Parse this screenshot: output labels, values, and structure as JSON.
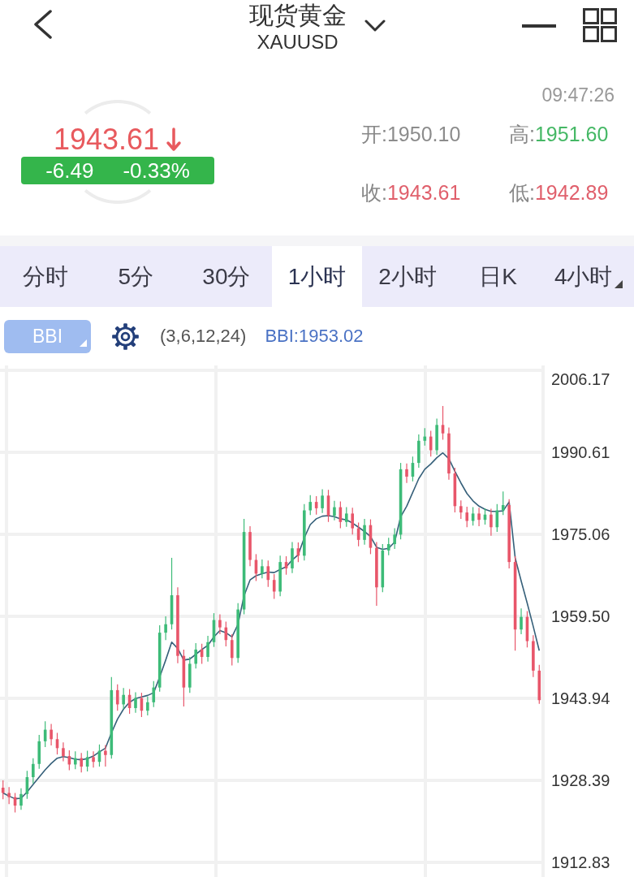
{
  "header": {
    "title": "现货黄金",
    "symbol": "XAUUSD"
  },
  "quote": {
    "time": "09:47:26",
    "price": "1943.61",
    "rising": false,
    "change": "-6.49",
    "change_percent": "-0.33%",
    "stats": [
      {
        "label": "开:",
        "value": "1950.10",
        "color": "#8c8c8c"
      },
      {
        "label": "高:",
        "value": "1951.60",
        "color": "#45b865"
      },
      {
        "label": "收:",
        "value": "1943.61",
        "color": "#e0606c"
      },
      {
        "label": "低:",
        "value": "1942.89",
        "color": "#e0606c"
      }
    ]
  },
  "tabs": [
    {
      "label": "分时",
      "selected": false,
      "dropdown": false
    },
    {
      "label": "5分",
      "selected": false,
      "dropdown": false
    },
    {
      "label": "30分",
      "selected": false,
      "dropdown": false
    },
    {
      "label": "1小时",
      "selected": true,
      "dropdown": false
    },
    {
      "label": "2小时",
      "selected": false,
      "dropdown": false
    },
    {
      "label": "日K",
      "selected": false,
      "dropdown": false
    },
    {
      "label": "4小时",
      "selected": false,
      "dropdown": true
    }
  ],
  "indicator": {
    "name": "BBI",
    "dropdown": true,
    "params": "(3,6,12,24)",
    "reading": "BBI:1953.02"
  },
  "chart": {
    "chart_data": {
      "type": "candlestick",
      "grid": true,
      "ylim": [
        1912.83,
        2006.17
      ],
      "yticks": [
        {
          "value": 2006.17,
          "label": "2006.17"
        },
        {
          "value": 1990.61,
          "label": "1990.61"
        },
        {
          "value": 1975.06,
          "label": "1975.06"
        },
        {
          "value": 1959.5,
          "label": "1959.50"
        },
        {
          "value": 1943.94,
          "label": "1943.94"
        },
        {
          "value": 1928.39,
          "label": "1928.39"
        },
        {
          "value": 1912.83,
          "label": "1912.83"
        }
      ],
      "categories": [
        null,
        null,
        null,
        null,
        null,
        null,
        null,
        null,
        null,
        null,
        null,
        null,
        null,
        null,
        null,
        null,
        null,
        null,
        null,
        null,
        null,
        null,
        null,
        null,
        null,
        null,
        null,
        null,
        null,
        null,
        null,
        null,
        null,
        null,
        null,
        null,
        null,
        null,
        null,
        null,
        null,
        null,
        null,
        null,
        null,
        null,
        null,
        null,
        null,
        null,
        null,
        null,
        null,
        null,
        null,
        null,
        null,
        null,
        null,
        null,
        null,
        null,
        null,
        null,
        null,
        null,
        null,
        null,
        null,
        null,
        null,
        null,
        null,
        null,
        null,
        null,
        null,
        null,
        null,
        null,
        null,
        null,
        null,
        null,
        null,
        null,
        null,
        null,
        null,
        null
      ],
      "ohlc": [
        [
          1927.0,
          1928.4,
          1924.8,
          1926.0
        ],
        [
          1926.0,
          1927.1,
          1923.9,
          1925.2
        ],
        [
          1925.2,
          1926.0,
          1922.3,
          1923.6
        ],
        [
          1923.6,
          1926.9,
          1922.8,
          1925.8
        ],
        [
          1925.8,
          1930.2,
          1924.9,
          1929.0
        ],
        [
          1929.0,
          1932.6,
          1927.8,
          1931.5
        ],
        [
          1931.5,
          1937.0,
          1930.6,
          1935.8
        ],
        [
          1935.8,
          1939.6,
          1934.7,
          1938.0
        ],
        [
          1938.0,
          1939.1,
          1935.0,
          1936.2
        ],
        [
          1936.2,
          1937.4,
          1933.3,
          1934.5
        ],
        [
          1934.5,
          1935.6,
          1932.0,
          1933.0
        ],
        [
          1933.0,
          1934.1,
          1930.3,
          1931.4
        ],
        [
          1931.4,
          1933.9,
          1930.5,
          1932.6
        ],
        [
          1932.6,
          1933.6,
          1929.9,
          1931.0
        ],
        [
          1931.0,
          1934.0,
          1930.1,
          1932.8
        ],
        [
          1932.8,
          1933.9,
          1930.8,
          1931.9
        ],
        [
          1931.9,
          1935.2,
          1931.0,
          1934.0
        ],
        [
          1934.0,
          1935.1,
          1931.0,
          1933.2
        ],
        [
          1933.2,
          1948.0,
          1932.5,
          1945.5
        ],
        [
          1945.5,
          1946.6,
          1941.6,
          1942.8
        ],
        [
          1942.8,
          1945.9,
          1941.9,
          1944.6
        ],
        [
          1944.6,
          1945.7,
          1941.0,
          1942.1
        ],
        [
          1942.1,
          1945.1,
          1941.2,
          1944.0
        ],
        [
          1944.0,
          1945.0,
          1940.4,
          1941.6
        ],
        [
          1941.6,
          1944.3,
          1940.7,
          1943.2
        ],
        [
          1943.2,
          1947.2,
          1942.3,
          1946.0
        ],
        [
          1946.0,
          1957.8,
          1945.2,
          1956.4
        ],
        [
          1956.4,
          1959.5,
          1955.0,
          1958.0
        ],
        [
          1958.0,
          1970.6,
          1957.0,
          1963.5
        ],
        [
          1963.5,
          1965.0,
          1950.6,
          1952.0
        ],
        [
          1952.0,
          1953.2,
          1942.4,
          1946.0
        ],
        [
          1946.0,
          1951.8,
          1945.0,
          1950.5
        ],
        [
          1950.5,
          1954.4,
          1949.6,
          1953.2
        ],
        [
          1953.2,
          1954.3,
          1950.5,
          1951.8
        ],
        [
          1951.8,
          1955.8,
          1950.9,
          1954.6
        ],
        [
          1954.6,
          1960.1,
          1953.7,
          1958.8
        ],
        [
          1958.8,
          1959.9,
          1956.1,
          1957.4
        ],
        [
          1957.4,
          1958.5,
          1953.8,
          1955.0
        ],
        [
          1955.0,
          1956.1,
          1950.2,
          1951.6
        ],
        [
          1951.6,
          1962.0,
          1950.7,
          1960.8
        ],
        [
          1960.8,
          1978.0,
          1959.9,
          1975.5
        ],
        [
          1975.5,
          1976.6,
          1969.0,
          1970.2
        ],
        [
          1970.2,
          1971.3,
          1966.2,
          1967.6
        ],
        [
          1967.6,
          1970.3,
          1966.7,
          1969.0
        ],
        [
          1969.0,
          1970.1,
          1965.1,
          1966.4
        ],
        [
          1966.4,
          1967.5,
          1962.8,
          1964.2
        ],
        [
          1964.2,
          1971.0,
          1963.3,
          1969.8
        ],
        [
          1969.8,
          1970.9,
          1967.4,
          1968.6
        ],
        [
          1968.6,
          1973.6,
          1967.7,
          1972.4
        ],
        [
          1972.4,
          1973.5,
          1969.8,
          1971.0
        ],
        [
          1971.0,
          1980.8,
          1970.1,
          1979.6
        ],
        [
          1979.6,
          1982.5,
          1978.7,
          1981.2
        ],
        [
          1981.2,
          1982.3,
          1978.8,
          1980.0
        ],
        [
          1980.0,
          1983.6,
          1979.1,
          1982.4
        ],
        [
          1982.4,
          1983.5,
          1977.4,
          1978.6
        ],
        [
          1978.6,
          1981.4,
          1977.7,
          1980.2
        ],
        [
          1980.2,
          1981.3,
          1976.2,
          1977.4
        ],
        [
          1977.4,
          1980.2,
          1976.5,
          1979.0
        ],
        [
          1979.0,
          1980.1,
          1975.0,
          1976.2
        ],
        [
          1976.2,
          1977.3,
          1972.8,
          1974.0
        ],
        [
          1974.0,
          1978.0,
          1973.1,
          1976.8
        ],
        [
          1976.8,
          1977.9,
          1971.3,
          1972.5
        ],
        [
          1972.5,
          1973.6,
          1961.5,
          1965.0
        ],
        [
          1965.0,
          1973.2,
          1964.1,
          1972.0
        ],
        [
          1972.0,
          1974.4,
          1971.1,
          1973.2
        ],
        [
          1973.2,
          1976.2,
          1972.3,
          1975.0
        ],
        [
          1975.0,
          1988.6,
          1974.1,
          1987.4
        ],
        [
          1987.4,
          1988.5,
          1984.8,
          1986.0
        ],
        [
          1986.0,
          1989.8,
          1985.1,
          1988.6
        ],
        [
          1988.6,
          1994.0,
          1987.7,
          1992.8
        ],
        [
          1992.8,
          1995.2,
          1991.9,
          1993.6
        ],
        [
          1993.6,
          1994.7,
          1989.8,
          1991.0
        ],
        [
          1991.0,
          1997.0,
          1990.1,
          1995.8
        ],
        [
          1995.8,
          1999.4,
          1993.0,
          1994.2
        ],
        [
          1994.2,
          1995.3,
          1985.4,
          1986.6
        ],
        [
          1986.6,
          1987.7,
          1979.2,
          1980.4
        ],
        [
          1980.4,
          1981.5,
          1978.0,
          1979.2
        ],
        [
          1979.2,
          1980.3,
          1976.4,
          1977.6
        ],
        [
          1977.6,
          1980.2,
          1976.7,
          1979.0
        ],
        [
          1979.0,
          1980.1,
          1976.6,
          1977.8
        ],
        [
          1977.8,
          1980.0,
          1976.9,
          1978.8
        ],
        [
          1978.8,
          1979.9,
          1974.8,
          1976.4
        ],
        [
          1976.4,
          1980.8,
          1975.5,
          1979.6
        ],
        [
          1979.6,
          1983.2,
          1978.7,
          1980.6
        ],
        [
          1980.6,
          1981.7,
          1968.6,
          1969.8
        ],
        [
          1969.8,
          1970.9,
          1953.0,
          1957.0
        ],
        [
          1957.0,
          1961.0,
          1956.1,
          1959.4
        ],
        [
          1959.4,
          1960.5,
          1953.6,
          1954.8
        ],
        [
          1954.8,
          1955.9,
          1948.0,
          1949.2
        ],
        [
          1949.2,
          1950.3,
          1942.9,
          1943.6
        ]
      ],
      "series": [
        {
          "type": "line",
          "color": "#36607a",
          "values": [
            1926.0,
            1925.4,
            1924.9,
            1925.0,
            1926.2,
            1927.6,
            1929.0,
            1930.4,
            1931.6,
            1932.6,
            1932.9,
            1932.7,
            1932.4,
            1932.3,
            1932.5,
            1933.0,
            1933.8,
            1934.5,
            1937.4,
            1940.0,
            1941.9,
            1943.2,
            1943.9,
            1944.2,
            1944.5,
            1945.0,
            1948.0,
            1951.2,
            1954.6,
            1953.4,
            1951.2,
            1951.4,
            1952.3,
            1953.2,
            1954.0,
            1955.6,
            1956.8,
            1956.4,
            1955.6,
            1958.0,
            1963.4,
            1966.4,
            1967.2,
            1967.6,
            1967.9,
            1967.8,
            1968.4,
            1968.9,
            1970.2,
            1971.2,
            1974.4,
            1976.9,
            1978.0,
            1978.5,
            1978.6,
            1978.4,
            1978.0,
            1977.8,
            1977.2,
            1976.4,
            1975.6,
            1974.6,
            1972.6,
            1972.2,
            1972.4,
            1973.6,
            1978.4,
            1980.4,
            1983.0,
            1985.6,
            1987.4,
            1988.4,
            1989.6,
            1990.5,
            1989.4,
            1987.0,
            1984.8,
            1982.8,
            1981.4,
            1980.4,
            1979.8,
            1979.4,
            1979.4,
            1979.5,
            1981.2,
            1970.6,
            1966.2,
            1962.0,
            1957.6,
            1953.0
          ]
        }
      ]
    }
  }
}
